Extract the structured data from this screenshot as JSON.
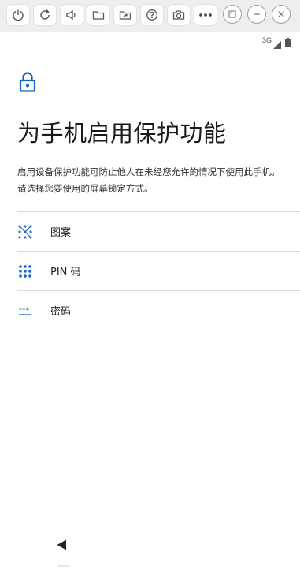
{
  "toolbar": {
    "buttons": [
      {
        "name": "power-icon"
      },
      {
        "name": "rotate-icon"
      },
      {
        "name": "volume-icon"
      },
      {
        "name": "folder-icon"
      },
      {
        "name": "share-folder-icon"
      },
      {
        "name": "help-icon"
      },
      {
        "name": "screenshot-camera-icon"
      },
      {
        "name": "more-icon"
      }
    ],
    "window_controls": [
      "restore-icon",
      "minimize-icon",
      "close-icon"
    ]
  },
  "status_bar": {
    "network": "3G"
  },
  "page": {
    "lock_icon": "lock-icon",
    "title": "为手机启用保护功能",
    "description": "启用设备保护功能可防止他人在未经您允许的情况下使用此手机。请选择您要使用的屏幕锁定方式。",
    "options": [
      {
        "label": "图案",
        "icon": "pattern-icon"
      },
      {
        "label": "PIN 码",
        "icon": "pin-icon"
      },
      {
        "label": "密码",
        "icon": "password-icon"
      }
    ]
  },
  "colors": {
    "accent": "#1a73e8",
    "icon_blue": "#1565c0",
    "title_text": "#1a1a1a"
  },
  "navigation": {
    "back_icon": "back-icon"
  }
}
